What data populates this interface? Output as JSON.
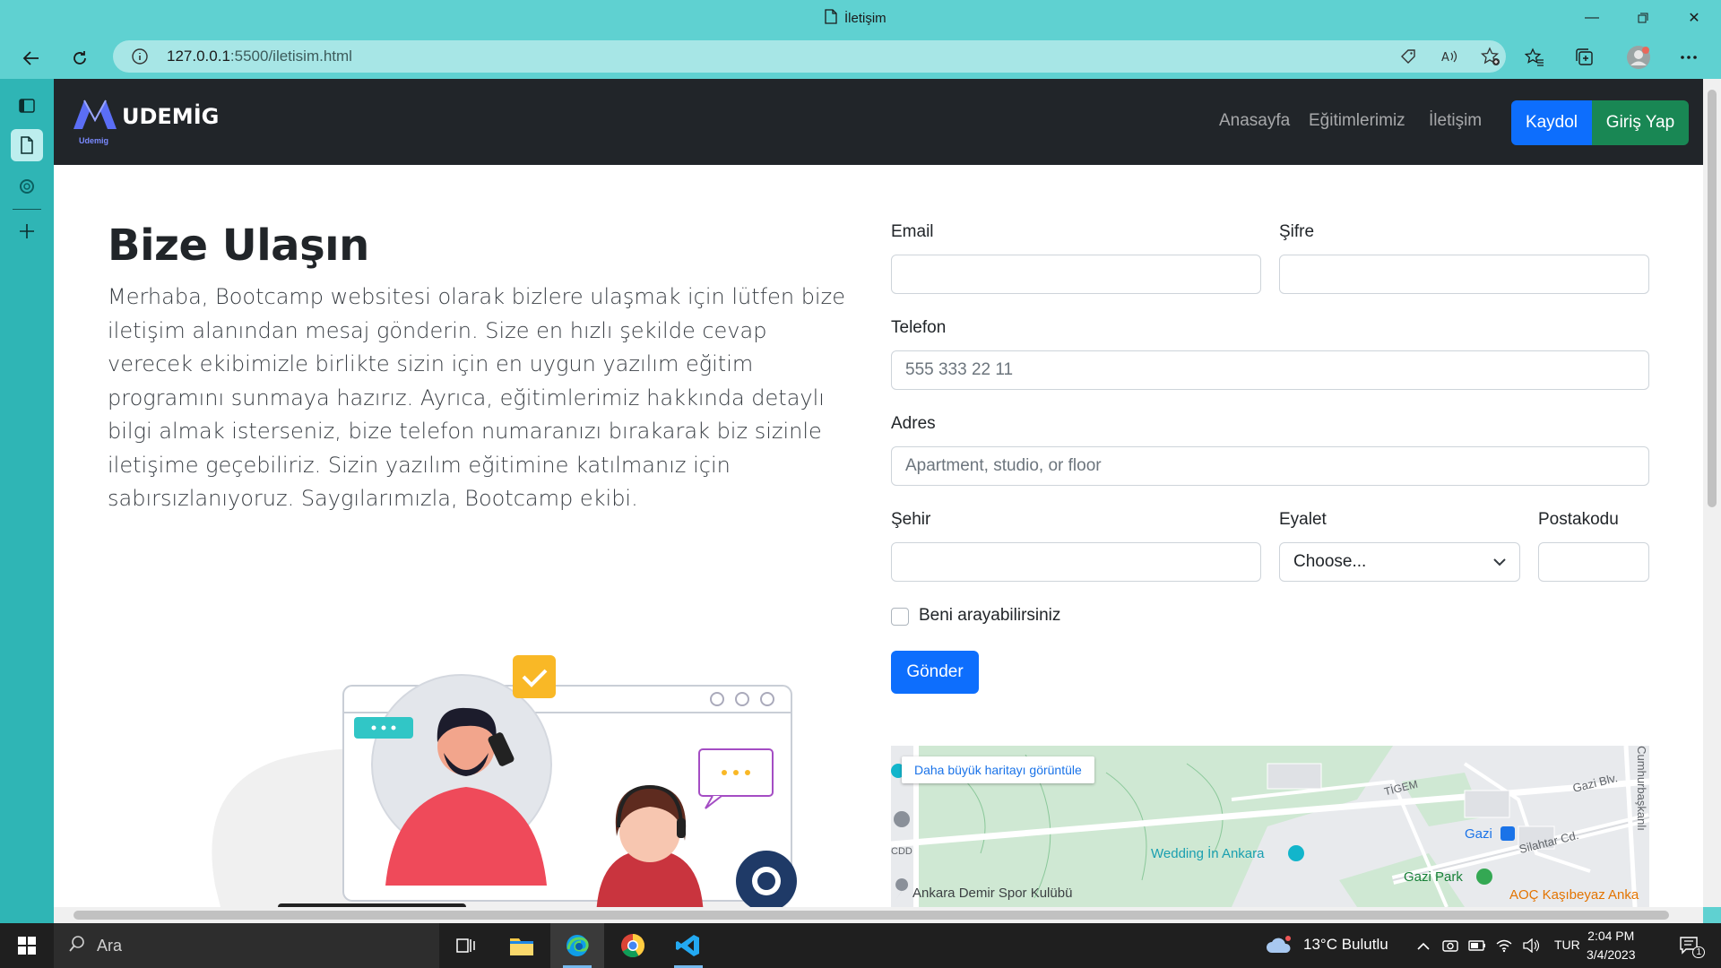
{
  "browser": {
    "tab_title": "İletişim",
    "url_host": "127.0.0.1",
    "url_rest": ":5500/iletisim.html"
  },
  "site": {
    "brand": "UDEMİG",
    "brand_sub": "Udemig",
    "nav": [
      "Anasayfa",
      "Eğitimlerimiz",
      "İletişim"
    ],
    "btn_register": "Kaydol",
    "btn_login": "Giriş Yap"
  },
  "hero": {
    "title": "Bize Ulaşın",
    "text": "Merhaba, Bootcamp websitesi olarak bizlere ulaşmak için lütfen bize iletişim alanından mesaj gönderin. Size en hızlı şekilde cevap verecek ekibimizle birlikte sizin için en uygun yazılım eğitim programını sunmaya hazırız. Ayrıca, eğitimlerimiz hakkında detaylı bilgi almak isterseniz, bize telefon numaranızı bırakarak biz sizinle iletişime geçebiliriz. Sizin yazılım eğitimine katılmanız için sabırsızlanıyoruz. Saygılarımızla, Bootcamp ekibi."
  },
  "form": {
    "email_label": "Email",
    "password_label": "Şifre",
    "phone_label": "Telefon",
    "phone_placeholder": "555 333 22 11",
    "address_label": "Adres",
    "address_placeholder": "Apartment, studio, or floor",
    "city_label": "Şehir",
    "state_label": "Eyalet",
    "state_selected": "Choose...",
    "zip_label": "Postakodu",
    "callback_label": "Beni arayabilirsiniz",
    "submit_label": "Gönder"
  },
  "map": {
    "view_larger": "Daha büyük haritayı görüntüle",
    "places": [
      "Wedding İn Ankara",
      "Gazi Park",
      "Ankara Demir Spor Kulübü",
      "Gazi",
      "Silahtar Cd.",
      "Gazi Blv.",
      "TİGEM",
      "Cumhurbaşkanlı",
      "AOÇ Kaşıbeyaz Anka",
      "CDD"
    ]
  },
  "taskbar": {
    "search_text": "Ara",
    "weather": "13°C  Bulutlu",
    "lang": "TUR",
    "time": "2:04 PM",
    "date": "3/4/2023",
    "notif_count": "1"
  },
  "colors": {
    "chrome": "#5fd1d1",
    "sidebar": "#2fb5b5",
    "navbar": "#212529",
    "primary": "#0d6efd",
    "success": "#198754"
  }
}
